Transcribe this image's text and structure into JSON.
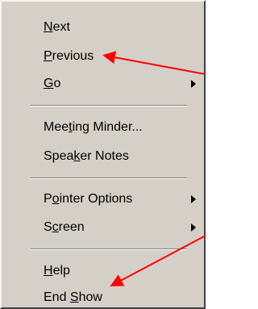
{
  "menu": {
    "items": [
      {
        "pre": "",
        "mnemonic": "N",
        "post": "ext",
        "has_submenu": false
      },
      {
        "pre": "",
        "mnemonic": "P",
        "post": "revious",
        "has_submenu": false
      },
      {
        "pre": "",
        "mnemonic": "G",
        "post": "o",
        "has_submenu": true
      },
      {
        "pre": "Mee",
        "mnemonic": "t",
        "post": "ing Minder...",
        "has_submenu": false
      },
      {
        "pre": "Spea",
        "mnemonic": "k",
        "post": "er Notes",
        "has_submenu": false
      },
      {
        "pre": "P",
        "mnemonic": "o",
        "post": "inter Options",
        "has_submenu": true
      },
      {
        "pre": "S",
        "mnemonic": "c",
        "post": "reen",
        "has_submenu": true
      },
      {
        "pre": "",
        "mnemonic": "H",
        "post": "elp",
        "has_submenu": false
      },
      {
        "pre": "End ",
        "mnemonic": "S",
        "post": "how",
        "has_submenu": false
      }
    ]
  },
  "colors": {
    "menu_background": "#d4d0c8",
    "arrow_color": "#ff0000"
  },
  "annotations": {
    "arrows": [
      {
        "target": "Previous"
      },
      {
        "target": "End Show"
      }
    ]
  }
}
